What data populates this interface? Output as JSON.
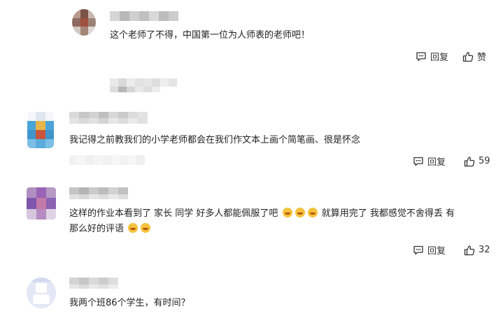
{
  "comments": [
    {
      "text": "这个老师了不得，中国第一位为人师表的老师吧！",
      "reply_label": "回复",
      "like_label": "赞",
      "like_count": ""
    },
    {
      "text": "我记得之前教我们的小学老师都会在我们作文本上画个简笔画、很是怀念",
      "reply_label": "回复",
      "like_label": "",
      "like_count": "59"
    },
    {
      "text_line1_a": "这样的作业本看到了 家长 同学 好多人都能佩服了吧",
      "text_line1_b": "就算用完了 我都感觉不舍得丢 有",
      "text_line2": "那么好的评语",
      "reply_label": "回复",
      "like_label": "",
      "like_count": "32"
    },
    {
      "text": "我两个班86个学生，有时间？"
    }
  ],
  "colors": {
    "text": "#222222",
    "muted": "#999999",
    "mosaic_gray": "#c8c8c8"
  },
  "icons": [
    "chat-bubble-icon",
    "thumbs-up-icon",
    "laugh-cry-emoji"
  ]
}
